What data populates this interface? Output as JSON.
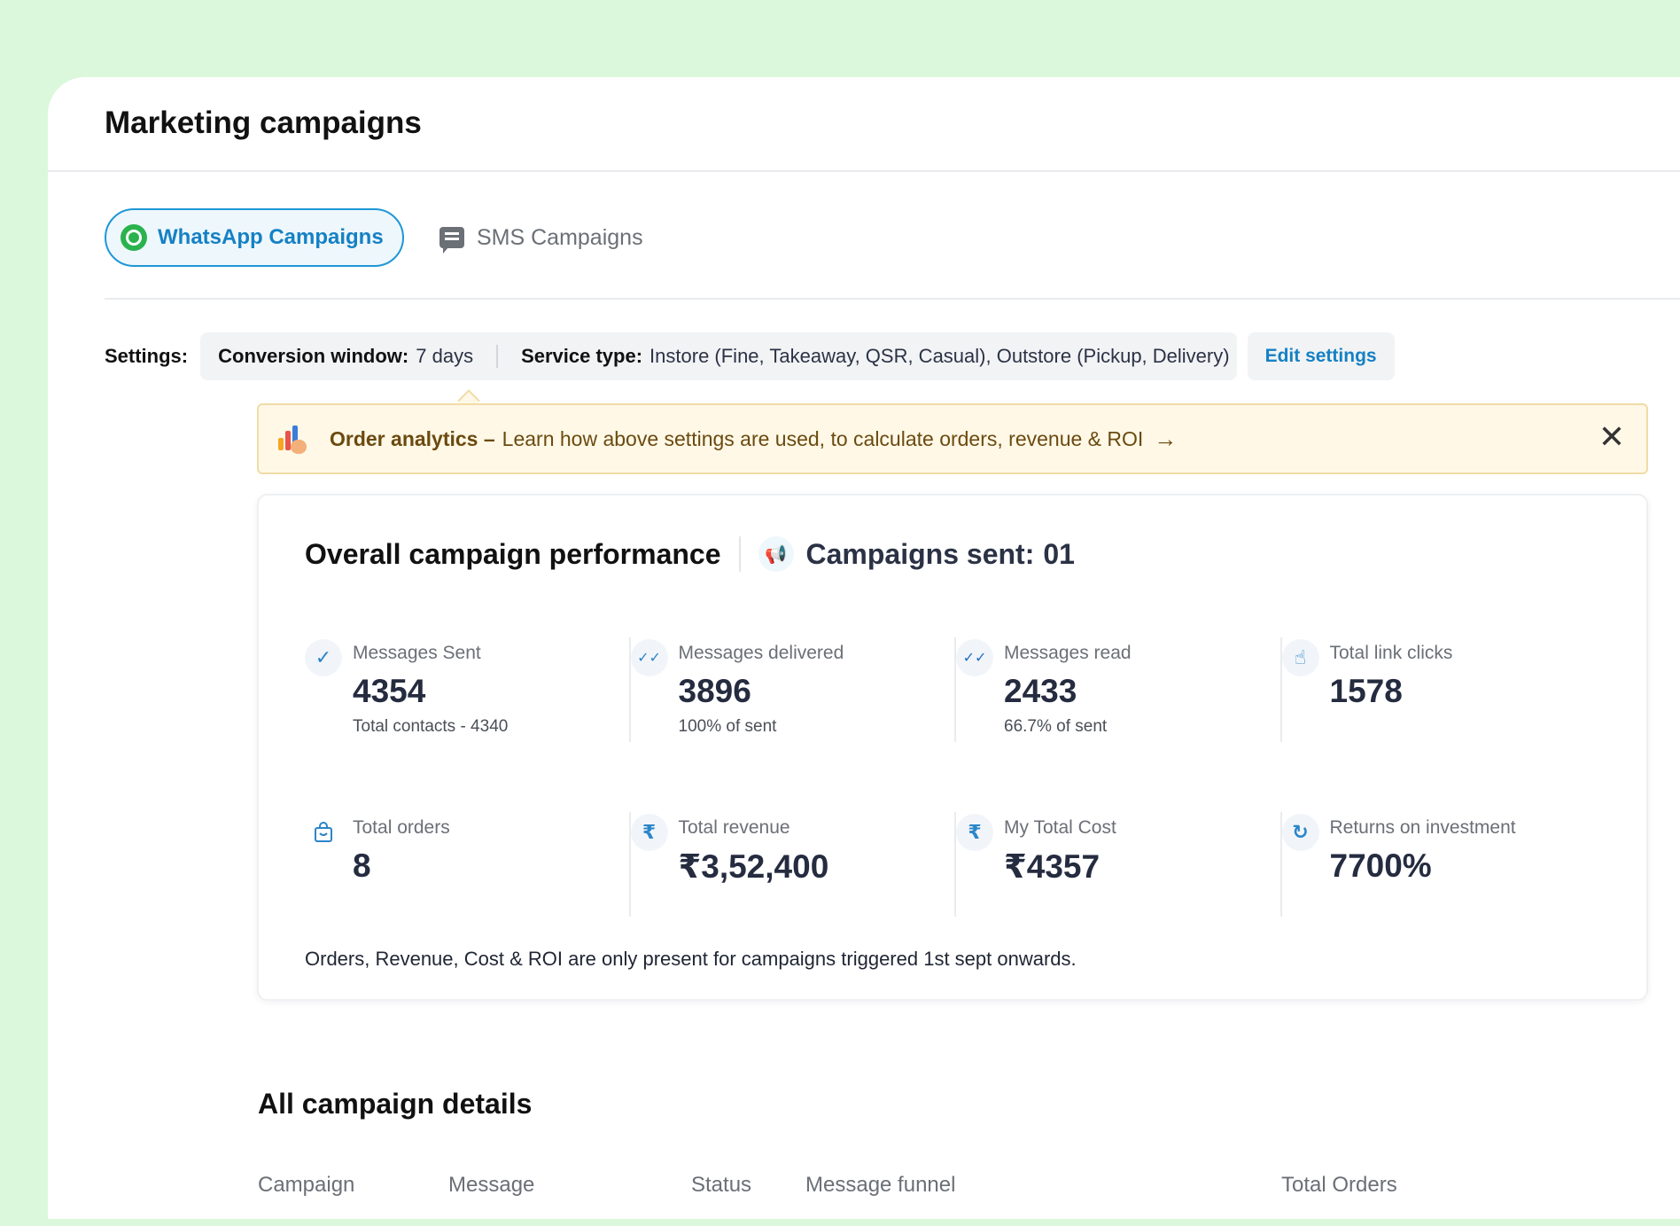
{
  "page": {
    "title": "Marketing campaigns"
  },
  "tabs": {
    "whatsapp": "WhatsApp Campaigns",
    "sms": "SMS Campaigns"
  },
  "settings": {
    "label": "Settings:",
    "conversion_label": "Conversion window:",
    "conversion_value": "7 days",
    "service_label": "Service type:",
    "service_value": "Instore (Fine, Takeaway, QSR, Casual), Outstore (Pickup, Delivery)",
    "edit": "Edit settings"
  },
  "banner": {
    "strong": "Order analytics –",
    "text": "Learn how above settings are used, to calculate orders, revenue & ROI",
    "arrow": "→",
    "close": "✕"
  },
  "performance": {
    "title": "Overall campaign performance",
    "campaigns_sent_label": "Campaigns sent:",
    "campaigns_sent_value": "01",
    "metrics_row1": [
      {
        "icon": "check-icon",
        "glyph": "✓",
        "label": "Messages Sent",
        "value": "4354",
        "sub": "Total contacts - 4340"
      },
      {
        "icon": "double-check-icon",
        "glyph": "✓✓",
        "label": "Messages delivered",
        "value": "3896",
        "sub": "100% of sent"
      },
      {
        "icon": "double-check-read-icon",
        "glyph": "✓✓",
        "label": "Messages read",
        "value": "2433",
        "sub": "66.7% of sent"
      },
      {
        "icon": "pointer-click-icon",
        "glyph": "☝",
        "label": "Total link clicks",
        "value": "1578",
        "sub": ""
      }
    ],
    "metrics_row2": [
      {
        "icon": "shopping-bag-icon",
        "glyph": "🛍",
        "label": "Total orders",
        "value": "8",
        "sub": ""
      },
      {
        "icon": "rupee-icon",
        "glyph": "₹",
        "label": "Total revenue",
        "value": "₹3,52,400",
        "sub": ""
      },
      {
        "icon": "rupee-icon",
        "glyph": "₹",
        "label": "My Total Cost",
        "value": "₹4357",
        "sub": ""
      },
      {
        "icon": "roi-icon",
        "glyph": "↻",
        "label": "Returns on investment",
        "value": "7700%",
        "sub": ""
      }
    ],
    "note": "Orders, Revenue, Cost & ROI are only present for campaigns triggered 1st sept onwards."
  },
  "details": {
    "title": "All campaign details",
    "columns": [
      "Campaign",
      "Message",
      "Status",
      "Message funnel",
      "Total Orders"
    ]
  }
}
